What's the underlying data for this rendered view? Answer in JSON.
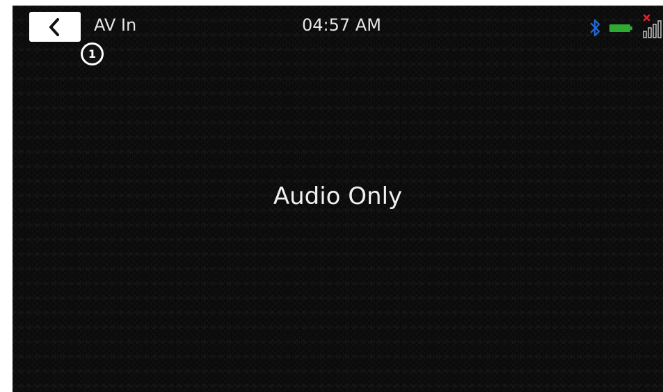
{
  "header": {
    "title": "AV In",
    "time": "04:57 AM",
    "callout_number": "1"
  },
  "main": {
    "message": "Audio Only"
  },
  "status_icons": [
    "bluetooth-icon",
    "battery-icon",
    "signal-disconnected-icon"
  ],
  "colors": {
    "background": "#0b0b0b",
    "text": "#e6e6e6",
    "bluetooth": "#1f66d1",
    "battery": "#2eaa33",
    "disconnected": "#e0242c"
  }
}
